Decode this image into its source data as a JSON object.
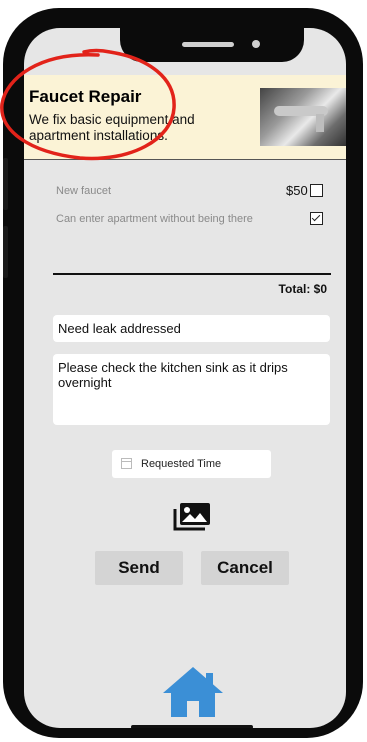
{
  "banner": {
    "title": "Faucet Repair",
    "description": "We fix basic equipment and apartment installations."
  },
  "options": [
    {
      "label": "New faucet",
      "price": "$50",
      "checked": false
    },
    {
      "label": "Can enter apartment without being there",
      "checked": true
    }
  ],
  "total": "Total: $0",
  "form": {
    "subject": "Need leak addressed",
    "details": "Please check the kitchen sink as it drips overnight",
    "requested_time": "Requested Time"
  },
  "buttons": {
    "send": "Send",
    "cancel": "Cancel"
  },
  "icons": {
    "photo": "image-gallery-icon",
    "home": "home-icon",
    "calendar": "calendar-icon"
  },
  "colors": {
    "banner_bg": "#fbf3d6",
    "home_icon": "#3b8fd6",
    "annotation": "#e2231a"
  }
}
